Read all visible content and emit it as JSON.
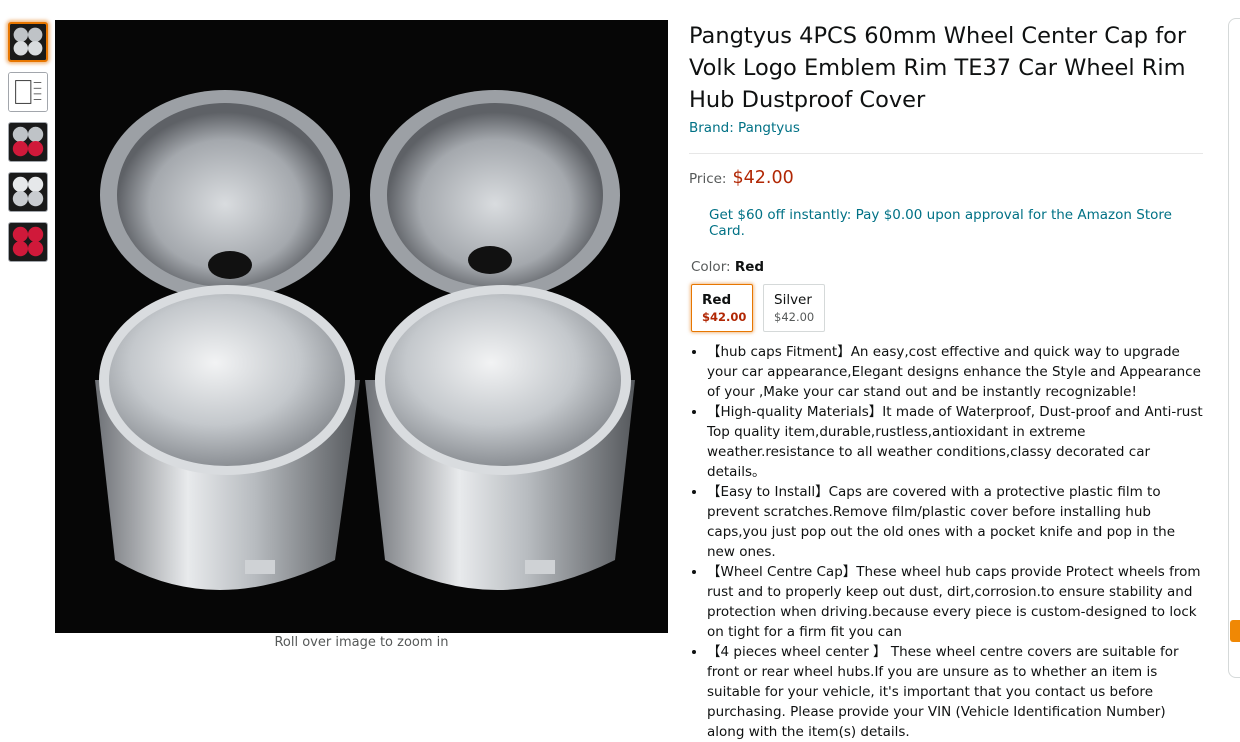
{
  "thumbnails": [
    {
      "name": "thumb-silver-caps",
      "selected": true
    },
    {
      "name": "thumb-dimension-diagram",
      "selected": false
    },
    {
      "name": "thumb-red-caps",
      "selected": false
    },
    {
      "name": "thumb-silver-caps-2",
      "selected": false
    },
    {
      "name": "thumb-red-caps-2",
      "selected": false
    }
  ],
  "image": {
    "zoom_hint": "Roll over image to zoom in"
  },
  "product": {
    "title": "Pangtyus 4PCS 60mm Wheel Center Cap for Volk Logo Emblem Rim TE37 Car Wheel Rim Hub Dustproof Cover",
    "brand": "Brand: Pangtyus",
    "price_label": "Price:",
    "price": "$42.00",
    "promo": "Get $60 off instantly: Pay $0.00 upon approval for the Amazon Store Card.",
    "color_label": "Color:",
    "color_value": "Red",
    "swatches": [
      {
        "name": "Red",
        "price": "$42.00",
        "selected": true
      },
      {
        "name": "Silver",
        "price": "$42.00",
        "selected": false
      }
    ],
    "bullets": [
      "【hub caps Fitment】An easy,cost effective and quick way to upgrade your car appearance,Elegant designs enhance the Style and Appearance of your ,Make your car stand out and be instantly recognizable!",
      "【High-quality Materials】It made of Waterproof, Dust-proof and Anti-rust Top quality item,durable,rustless,antioxidant in extreme weather.resistance to all weather conditions,classy decorated car details。",
      "【Easy to Install】Caps are covered with a protective plastic film to prevent scratches.Remove film/plastic cover before installing hub caps,you just pop out the old ones with a pocket knife and pop in the new ones.",
      "【Wheel Centre Cap】These wheel hub caps provide Protect wheels from rust and to properly keep out dust, dirt,corrosion.to ensure stability and protection when driving.because every piece is custom-designed to lock on tight for a firm fit you can",
      "【4 pieces wheel center 】 These wheel centre covers are suitable for front or rear wheel hubs.If you are unsure as to whether an item is suitable for your vehicle, it's important that you contact us before purchasing. Please provide your VIN (Vehicle Identification Number) along with the item(s) details."
    ]
  },
  "colors": {
    "link": "#007185",
    "price": "#b12704",
    "selected_border": "#e77600"
  }
}
